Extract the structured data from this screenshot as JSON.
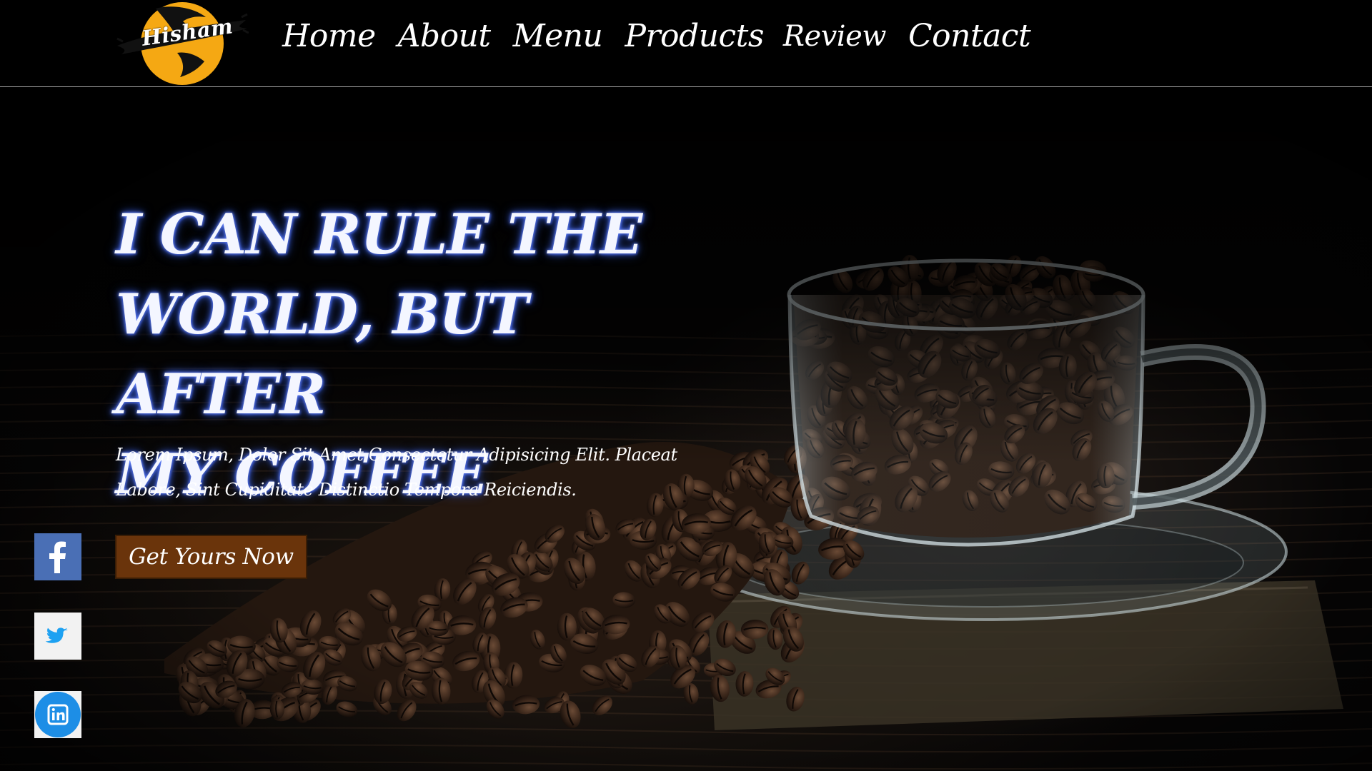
{
  "brand": {
    "logo_text": "Hisham",
    "accent_color": "#f5a813"
  },
  "nav": {
    "items": [
      {
        "label": "Home"
      },
      {
        "label": "About"
      },
      {
        "label": "Menu"
      },
      {
        "label": "Products"
      },
      {
        "label": "Review"
      },
      {
        "label": "Contact"
      }
    ]
  },
  "hero": {
    "headline_lines": [
      "I CAN RULE THE",
      "WORLD, BUT AFTER",
      "MY COFFEE"
    ],
    "subtext_lines": [
      "Lorem Ipsum, Dolor Sit Amet Consectetur Adipisicing Elit. Placeat",
      "Labore, Sint Cupiditate Distinctio Tempora Reiciendis."
    ],
    "cta_label": "Get Yours Now",
    "cta_color": "#6a340b",
    "image": "glass cup of coffee beans on saucer with spilled beans"
  },
  "social": [
    {
      "name": "facebook",
      "icon": "facebook-icon",
      "color": "#4267b2"
    },
    {
      "name": "twitter",
      "icon": "twitter-icon",
      "color": "#1da1f2"
    },
    {
      "name": "linkedin",
      "icon": "linkedin-icon",
      "color": "#0a66c2"
    }
  ]
}
